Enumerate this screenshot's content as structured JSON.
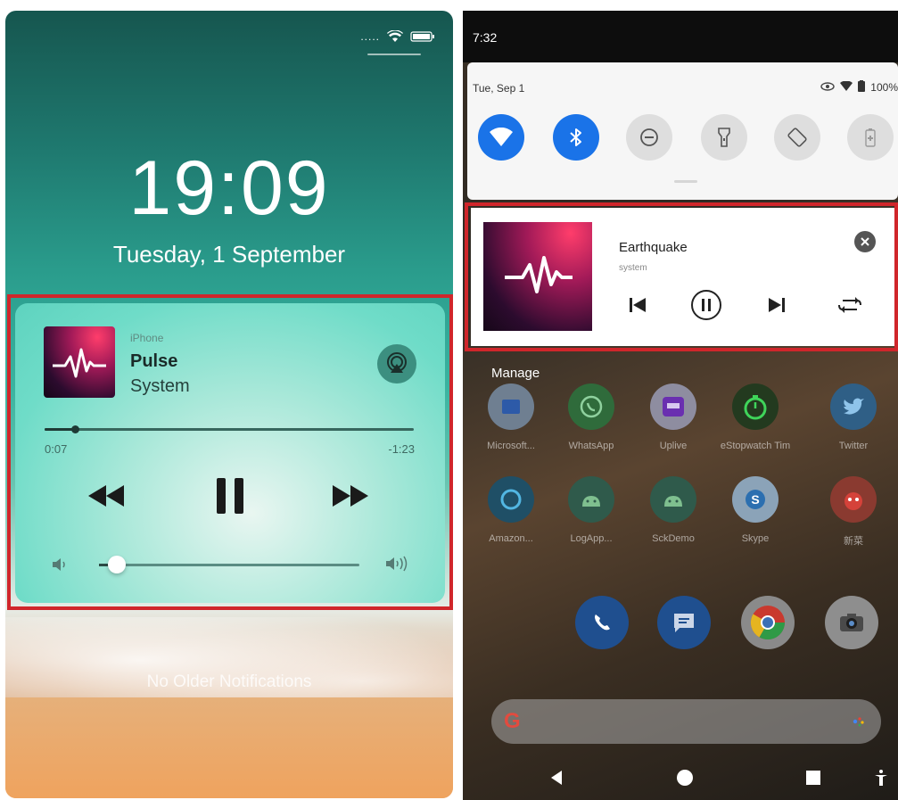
{
  "ios": {
    "time": "19:09",
    "date": "Tuesday, 1 September",
    "status": {
      "signal": ".....",
      "wifi_icon": "wifi-icon",
      "battery_icon": "battery-icon"
    },
    "player": {
      "source": "iPhone",
      "title": "Pulse",
      "artist": "System",
      "elapsed": "0:07",
      "remaining": "-1:23",
      "progress_fraction": 0.083,
      "volume_fraction": 0.07
    },
    "no_older": "No Older Notifications",
    "colors": {
      "highlight": "#d0262b",
      "widget_accent": "#5ed3bf"
    }
  },
  "android": {
    "time": "7:32",
    "date": "Tue, Sep 1",
    "battery": "100%",
    "quick_settings": [
      {
        "name": "wifi",
        "icon": "wifi-icon",
        "active": true
      },
      {
        "name": "bluetooth",
        "icon": "bluetooth-icon",
        "active": true
      },
      {
        "name": "do-not-disturb",
        "icon": "dnd-icon",
        "active": false
      },
      {
        "name": "flashlight",
        "icon": "flashlight-icon",
        "active": false
      },
      {
        "name": "auto-rotate",
        "icon": "rotate-icon",
        "active": false
      },
      {
        "name": "battery-saver",
        "icon": "battery-saver-icon",
        "active": false
      }
    ],
    "media": {
      "title": "Earthquake",
      "subtitle": "system"
    },
    "manage": "Manage",
    "apps_row1": [
      "Microsoft...",
      "WhatsApp",
      "Uplive",
      "eStopwatch Tim",
      "Twitter"
    ],
    "apps_row2": [
      "Amazon...",
      "LogApp...",
      "SckDemo",
      "Skype",
      "新菜"
    ],
    "dock": [
      "phone",
      "messages",
      "chrome",
      "camera"
    ],
    "search_logo": "G",
    "colors": {
      "accent": "#1a73e8",
      "highlight": "#d0262b"
    }
  }
}
